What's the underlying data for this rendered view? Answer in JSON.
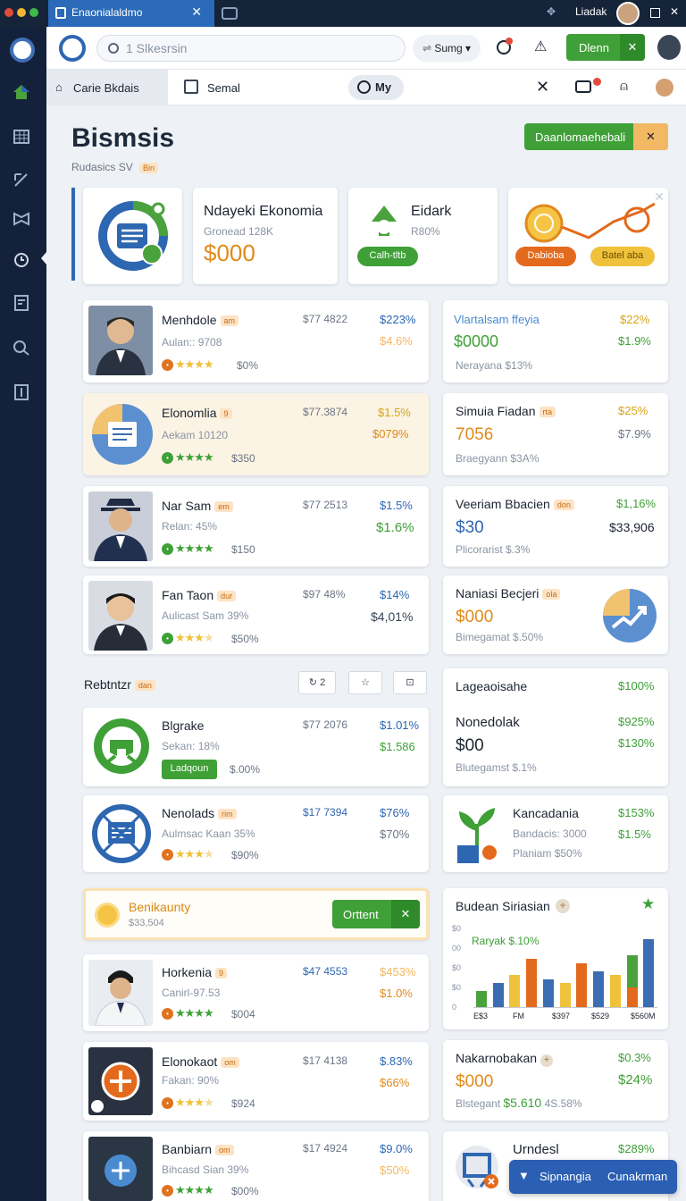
{
  "browser": {
    "tab_title": "Enaonialaldmo",
    "right_label": "Liadak"
  },
  "toolbar": {
    "search_placeholder": "1 Slkesrsin",
    "sort_label": "Sumg",
    "action_label": "Dlenn"
  },
  "subtabs": {
    "tab1": "Carie Bkdais",
    "tab2": "Semal",
    "tab3": "My"
  },
  "header": {
    "title": "Bismsis",
    "subtitle": "Rudasics SV",
    "subtitle_badge": "Bin",
    "download_label": "Daanlomaehebali"
  },
  "summary": {
    "c2_title": "Ndayeki Ekonomia",
    "c2_sub": "Gronead 128K",
    "c2_value": "$000",
    "c3_title": "Eidark",
    "c3_sub": "R80%",
    "c3_chip": "Calh-tltb",
    "c4_chip1": "Dabioba",
    "c4_chip2": "Batel aba"
  },
  "left_list": [
    {
      "name": "Menhdole",
      "badge": "am",
      "sub": "Aulan:: 9708",
      "val1": "$77 4822",
      "val2": "$223%",
      "val3": "$4.6%",
      "price": "$0%",
      "stars": 4
    },
    {
      "name": "Elonomlia",
      "badge": "9",
      "sub": "Aekam 10120",
      "val1": "$77.3874",
      "val2": "$1.5%",
      "val3": "$079%",
      "price": "$350",
      "stars": 4
    },
    {
      "name": "Nar Sam",
      "badge": "em",
      "sub": "Relan: 45%",
      "val1": "$77 2513",
      "val2": "$1.5%",
      "val3": "$1.6%",
      "price": "$150",
      "stars": 4
    },
    {
      "name": "Fan Taon",
      "badge": "dur",
      "sub": "Aulicast Sam 39%",
      "val1": "$97 48%",
      "val2": "$14%",
      "val3": "$4,01%",
      "price": "$50%",
      "stars": 3
    }
  ],
  "right_list": [
    {
      "title": "Vlartalsam ffeyia",
      "value": "$0000",
      "sub": "Nerayana $13%",
      "g1": "$22%",
      "g2": "$1.9%"
    },
    {
      "title": "Simuia Fiadan",
      "badge": "rta",
      "value": "7056",
      "sub": "Braegyann $3A%",
      "g1": "$25%",
      "g2": "$7.9%"
    },
    {
      "title": "Veeriam Bbacien",
      "badge": "don",
      "value": "$30",
      "sub": "Plicorarist $.3%",
      "g1": "$1,16%",
      "g2": "$33,906"
    },
    {
      "title": "Naniasi Becjeri",
      "badge": "ola",
      "value": "$000",
      "sub": "Bimegamat $.50%"
    }
  ],
  "section": {
    "title": "Rebtntzr",
    "badge": "dan",
    "count": "2"
  },
  "left_list2": [
    {
      "name": "Blgrake",
      "sub": "Sekan: 18%",
      "val1": "$77 2076",
      "val2": "$1.01%",
      "val3": "$1.586",
      "chip": "Ladqoun",
      "price": "$.00%"
    },
    {
      "name": "Nenolads",
      "badge": "rim",
      "sub": "Aulmsac Kaan 35%",
      "val1": "$17 7394",
      "val2": "$76%",
      "val3": "$70%",
      "price": "$90%",
      "stars": 3
    }
  ],
  "right_list2": [
    {
      "title": "Lageaoisahe",
      "g1": "$100%"
    },
    {
      "title": "Nonedolak",
      "value": "$00",
      "sub": "Blutegamst $.1%",
      "g1": "$925%",
      "g2": "$130%"
    },
    {
      "title": "Kancadania",
      "sub1": "Bandacis: 3000",
      "sub2": "Planiam $50%",
      "g1": "$153%",
      "g2": "$1.5%"
    }
  ],
  "promo": {
    "title": "Benikaunty",
    "sub": "$33,504",
    "button": "Orttent"
  },
  "chart_card": {
    "title": "Budean Siriasian"
  },
  "chart_data": {
    "type": "bar",
    "title": "Budean Siriasian",
    "annotation": "Raryak $.10%",
    "ytick_labels": [
      "$0",
      "00",
      "$0",
      "$0",
      "0"
    ],
    "xtick_labels": [
      "E$3",
      "FM",
      "$397",
      "$529",
      "$560M"
    ],
    "ylim": [
      0,
      10
    ],
    "series": [
      {
        "color": "#4aa23c",
        "values": [
          2,
          0,
          0,
          3.5,
          0,
          0,
          5,
          0,
          0,
          6.5,
          0
        ]
      },
      {
        "color": "#3b6db3",
        "values": [
          0,
          3,
          0,
          0,
          3.5,
          0,
          0,
          4.5,
          0,
          0,
          8.5
        ]
      },
      {
        "color": "#f0c13a",
        "values": [
          0,
          0,
          4,
          0,
          0,
          3,
          0,
          0,
          4,
          0,
          0
        ]
      },
      {
        "color": "#e36a1d",
        "values": [
          0,
          0,
          0,
          6,
          0,
          0,
          5.5,
          0,
          0,
          2.5,
          0
        ]
      }
    ]
  },
  "left_list3": [
    {
      "name": "Horkenia",
      "badge": "9",
      "sub": "Canirl-97.53",
      "val1": "$47 4553",
      "val2": "$453%",
      "val3": "$1.0%",
      "price": "$004",
      "stars": 4
    },
    {
      "name": "Elonokaot",
      "badge": "om",
      "sub": "Fakan: 90%",
      "val1": "$17 4138",
      "val2": "$.83%",
      "val3": "$66%",
      "price": "$924",
      "stars": 3
    },
    {
      "name": "Banbiarn",
      "badge": "om",
      "sub": "Bihcasd Sian 39%",
      "val1": "$17 4924",
      "val2": "$9.0%",
      "val3": "$50%",
      "price": "$00%",
      "stars": 4
    }
  ],
  "right_list3": [
    {
      "title": "Nakarnobakan",
      "value": "$000",
      "sub1": "Blstegant",
      "sub2": "$5.610",
      "sub3": "4S.58%",
      "g1": "$0.3%",
      "g2": "$24%"
    },
    {
      "title": "Urndesl",
      "g1": "$289%"
    }
  ],
  "bottom_bar": {
    "label1": "Sipnangia",
    "label2": "Cunakrman"
  }
}
